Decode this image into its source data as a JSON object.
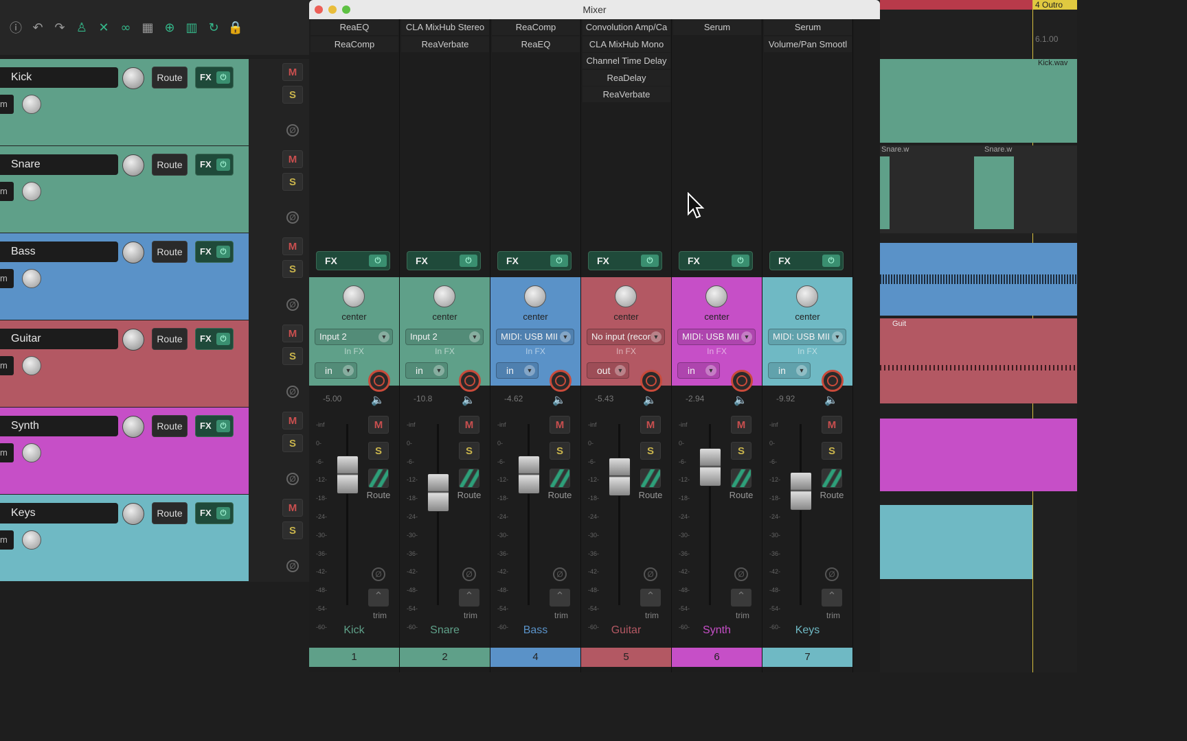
{
  "toolbar": {
    "icons": [
      "info-icon",
      "undo-icon",
      "redo-icon",
      "metronome-icon",
      "crossfade-icon",
      "link-icon",
      "grid-icon",
      "ripple-icon",
      "snap-grid-icon",
      "loop-icon",
      "lock-icon"
    ]
  },
  "tcp_tracks": [
    {
      "name": "Kick",
      "route": "Route",
      "fx": "FX",
      "in": "m",
      "color": "#5fa089"
    },
    {
      "name": "Snare",
      "route": "Route",
      "fx": "FX",
      "in": "m",
      "color": "#5fa089"
    },
    {
      "name": "Bass",
      "route": "Route",
      "fx": "FX",
      "in": "m",
      "color": "#5a92c8"
    },
    {
      "name": "Guitar",
      "route": "Route",
      "fx": "FX",
      "in": "m",
      "color": "#b35863"
    },
    {
      "name": "Synth",
      "route": "Route",
      "fx": "FX",
      "in": "m",
      "color": "#c64fc7"
    },
    {
      "name": "Keys",
      "route": "Route",
      "fx": "FX",
      "in": "m",
      "color": "#6fb9c4"
    }
  ],
  "ms": {
    "mute": "M",
    "solo": "S",
    "phase": "Ø"
  },
  "arrange": {
    "marker": "4 Outro",
    "ruler": "6.1.00",
    "clip_kick": "Kick.wav",
    "clip_snare_a": "Snare.w",
    "clip_snare_b": "Snare.w",
    "clip_guitar": "Guit"
  },
  "mixer": {
    "title": "Mixer",
    "center": "center",
    "infx": "In FX",
    "route": "Route",
    "trim": "trim",
    "fx": "FX",
    "scale": [
      "-inf",
      "0-",
      "-6-",
      "-12-",
      "-18-",
      "-24-",
      "-30-",
      "-36-",
      "-42-",
      "-48-",
      "-54-",
      "-60-"
    ],
    "strips": [
      {
        "name": "Kick",
        "num": "1",
        "color": "#5fa089",
        "fx": [
          "ReaEQ",
          "ReaComp"
        ],
        "input": "Input 2",
        "mode": "in",
        "db": "-5.00",
        "fader": 0.72
      },
      {
        "name": "Snare",
        "num": "2",
        "color": "#5fa089",
        "fx": [
          "CLA MixHub Stereo",
          "ReaVerbate"
        ],
        "input": "Input 2",
        "mode": "in",
        "db": "-10.8",
        "fader": 0.62
      },
      {
        "name": "Bass",
        "num": "4",
        "color": "#5a92c8",
        "fx": [
          "ReaComp",
          "ReaEQ"
        ],
        "input": "MIDI: USB MII",
        "mode": "in",
        "db": "-4.62",
        "fader": 0.72
      },
      {
        "name": "Guitar",
        "num": "5",
        "color": "#b35863",
        "fx": [
          "Convolution Amp/Ca",
          "CLA MixHub Mono",
          "Channel Time Delay",
          "ReaDelay",
          "ReaVerbate"
        ],
        "input": "No input (recor",
        "mode": "out",
        "db": "-5.43",
        "fader": 0.71
      },
      {
        "name": "Synth",
        "num": "6",
        "color": "#c64fc7",
        "fx": [
          "Serum"
        ],
        "input": "MIDI: USB MII",
        "mode": "in",
        "db": "-2.94",
        "fader": 0.76
      },
      {
        "name": "Keys",
        "num": "7",
        "color": "#6fb9c4",
        "fx": [
          "Serum",
          "Volume/Pan Smootl"
        ],
        "input": "MIDI: USB MII",
        "mode": "in",
        "db": "-9.92",
        "fader": 0.63
      }
    ]
  }
}
